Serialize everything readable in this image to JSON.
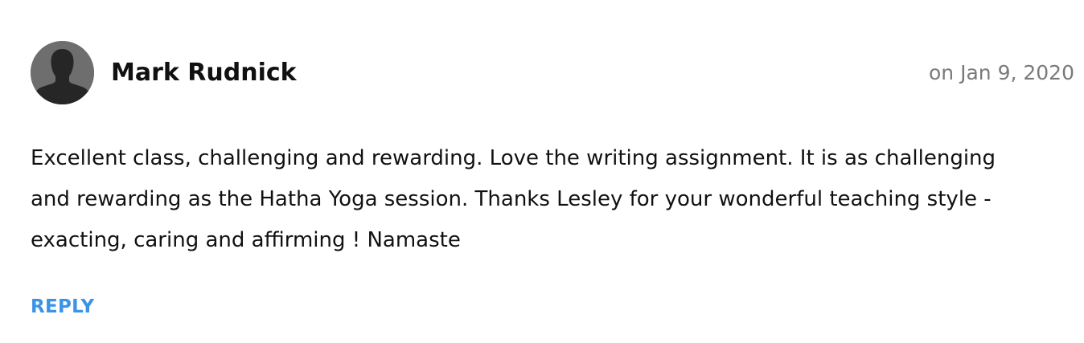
{
  "comment": {
    "author": "Mark Rudnick",
    "date": "on Jan 9, 2020",
    "text": "Excellent class, challenging and rewarding. Love the writing assignment. It is as challenging and rewarding as the Hatha Yoga session. Thanks Lesley for your wonderful teaching style - exacting, caring and affirming ! Namaste",
    "reply_label": "REPLY",
    "avatar_icon": "default-user-silhouette-icon"
  },
  "colors": {
    "author": "#111111",
    "date": "#7a7a7a",
    "text": "#111111",
    "reply": "#3b93e7",
    "avatar_bg": "#6e6e6e",
    "avatar_silhouette": "#262626"
  }
}
